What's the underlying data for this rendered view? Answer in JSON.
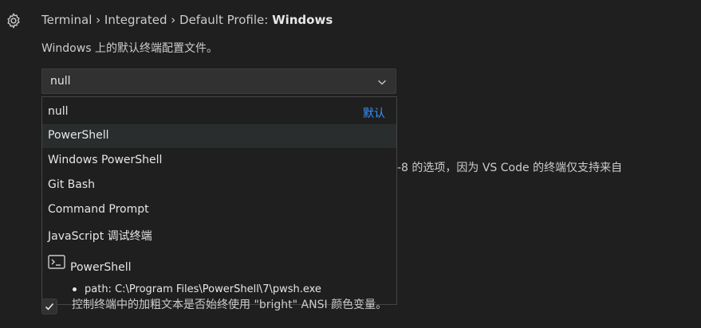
{
  "setting": {
    "breadcrumb": "Terminal › Integrated › Default Profile: ",
    "name": "Windows",
    "description": "Windows 上的默认终端配置文件。"
  },
  "select": {
    "value": "null"
  },
  "dropdown": {
    "options": [
      {
        "label": "null",
        "tag": "默认"
      },
      {
        "label": "PowerShell"
      },
      {
        "label": "Windows PowerShell"
      },
      {
        "label": "Git Bash"
      },
      {
        "label": "Command Prompt"
      },
      {
        "label": "JavaScript 调试终端"
      }
    ],
    "detail": {
      "icon": "terminal-icon",
      "title": "PowerShell",
      "bullet": "path: C:\\Program Files\\PowerShell\\7\\pwsh.exe"
    }
  },
  "background_text": {
    "partial_line": "-8 的选项，因为 VS Code 的终端仅支持来自",
    "checkbox_label": "控制终端中的加粗文本是否始终使用 \"bright\" ANSI 颜色变量。"
  },
  "colors": {
    "background": "#1f1f1f",
    "accent": "#3794ff",
    "hover": "#2a2d2e"
  }
}
